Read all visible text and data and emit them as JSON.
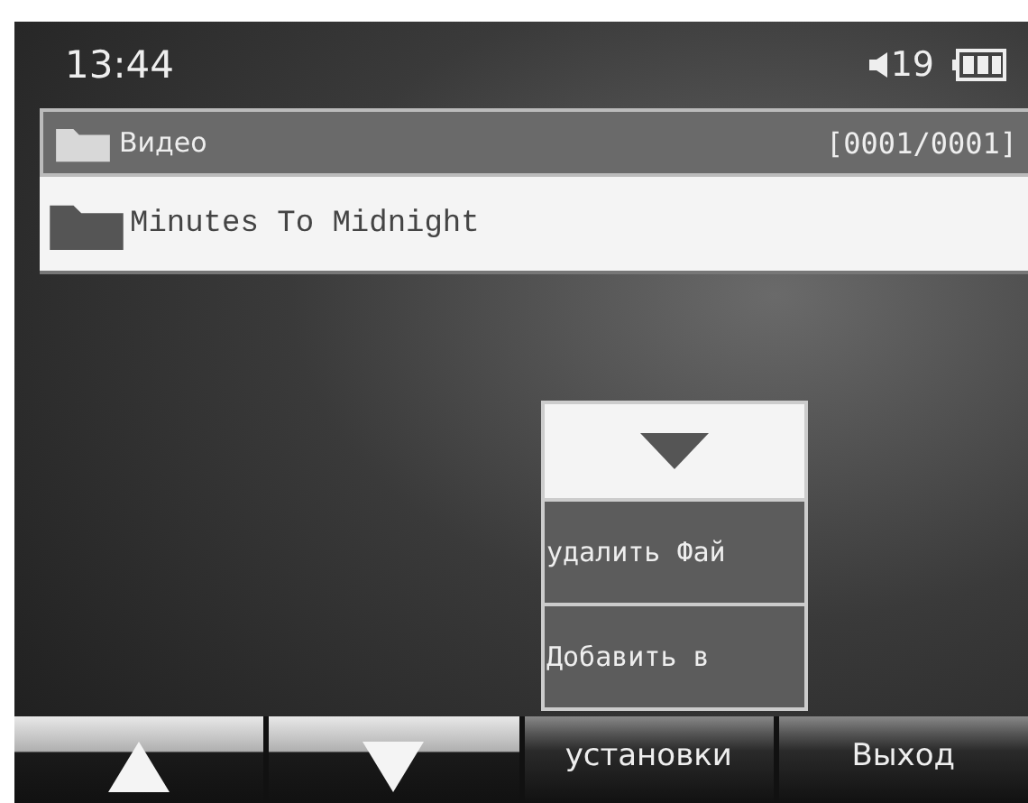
{
  "status_bar": {
    "time": "13:44",
    "volume": "19"
  },
  "header": {
    "title": "Видео",
    "counter": "[0001/0001]"
  },
  "files": [
    {
      "name": "Minutes To Midnight",
      "selected": true
    }
  ],
  "popup_menu": {
    "items": [
      {
        "label": "удалить Фай"
      },
      {
        "label": "Добавить в"
      }
    ]
  },
  "softkeys": [
    {
      "kind": "up"
    },
    {
      "kind": "down"
    },
    {
      "kind": "text",
      "label": "установки"
    },
    {
      "kind": "text",
      "label": "Выход"
    }
  ]
}
